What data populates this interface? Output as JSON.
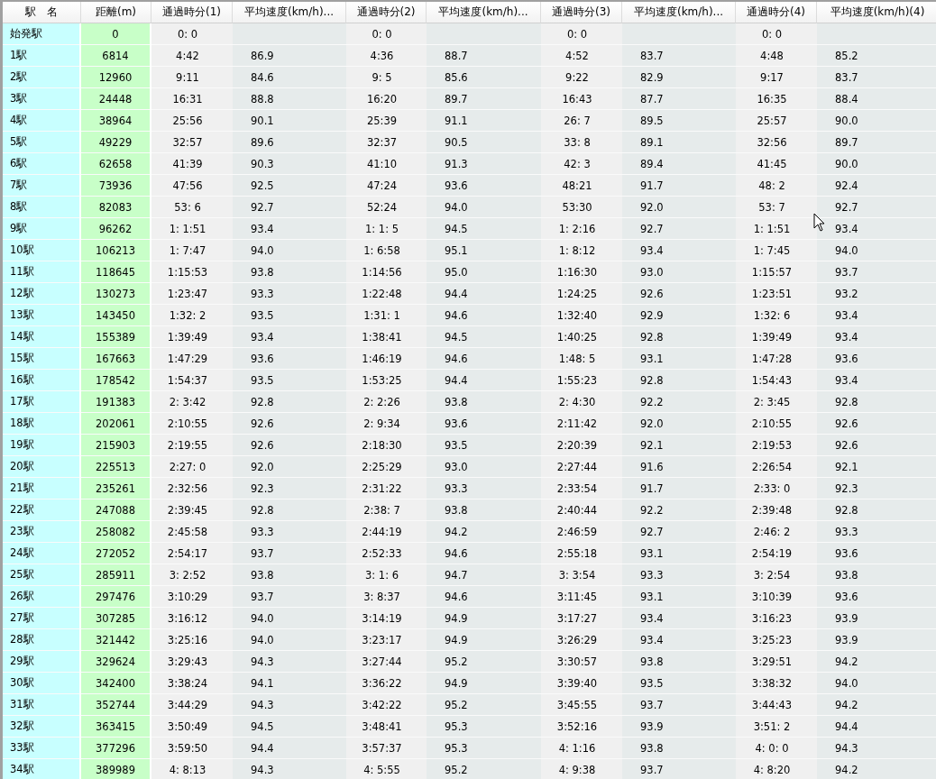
{
  "table": {
    "columns": [
      "駅　名",
      "距離(m)",
      "通過時分(1)",
      "平均速度(km/h)...",
      "通過時分(2)",
      "平均速度(km/h)...",
      "通過時分(3)",
      "平均速度(km/h)...",
      "通過時分(4)",
      "平均速度(km/h)(4)"
    ],
    "rows": [
      {
        "station": "始発駅",
        "distance": "0",
        "times": [
          "0: 0",
          "0: 0",
          "0: 0",
          "0: 0"
        ]
      },
      {
        "station": "1駅",
        "distance": "6814",
        "times": [
          "4:42",
          "4:36",
          "4:52",
          "4:48"
        ],
        "speeds": [
          "86.9",
          "88.7",
          "83.7",
          "85.2"
        ]
      },
      {
        "station": "2駅",
        "distance": "12960",
        "times": [
          "9:11",
          "9: 5",
          "9:22",
          "9:17"
        ],
        "speeds": [
          "84.6",
          "85.6",
          "82.9",
          "83.7"
        ]
      },
      {
        "station": "3駅",
        "distance": "24448",
        "times": [
          "16:31",
          "16:20",
          "16:43",
          "16:35"
        ],
        "speeds": [
          "88.8",
          "89.7",
          "87.7",
          "88.4"
        ]
      },
      {
        "station": "4駅",
        "distance": "38964",
        "times": [
          "25:56",
          "25:39",
          "26: 7",
          "25:57"
        ],
        "speeds": [
          "90.1",
          "91.1",
          "89.5",
          "90.0"
        ]
      },
      {
        "station": "5駅",
        "distance": "49229",
        "times": [
          "32:57",
          "32:37",
          "33: 8",
          "32:56"
        ],
        "speeds": [
          "89.6",
          "90.5",
          "89.1",
          "89.7"
        ]
      },
      {
        "station": "6駅",
        "distance": "62658",
        "times": [
          "41:39",
          "41:10",
          "42: 3",
          "41:45"
        ],
        "speeds": [
          "90.3",
          "91.3",
          "89.4",
          "90.0"
        ]
      },
      {
        "station": "7駅",
        "distance": "73936",
        "times": [
          "47:56",
          "47:24",
          "48:21",
          "48: 2"
        ],
        "speeds": [
          "92.5",
          "93.6",
          "91.7",
          "92.4"
        ]
      },
      {
        "station": "8駅",
        "distance": "82083",
        "times": [
          "53: 6",
          "52:24",
          "53:30",
          "53: 7"
        ],
        "speeds": [
          "92.7",
          "94.0",
          "92.0",
          "92.7"
        ]
      },
      {
        "station": "9駅",
        "distance": "96262",
        "times": [
          "1: 1:51",
          "1: 1: 5",
          "1: 2:16",
          "1: 1:51"
        ],
        "speeds": [
          "93.4",
          "94.5",
          "92.7",
          "93.4"
        ]
      },
      {
        "station": "10駅",
        "distance": "106213",
        "times": [
          "1: 7:47",
          "1: 6:58",
          "1: 8:12",
          "1: 7:45"
        ],
        "speeds": [
          "94.0",
          "95.1",
          "93.4",
          "94.0"
        ]
      },
      {
        "station": "11駅",
        "distance": "118645",
        "times": [
          "1:15:53",
          "1:14:56",
          "1:16:30",
          "1:15:57"
        ],
        "speeds": [
          "93.8",
          "95.0",
          "93.0",
          "93.7"
        ]
      },
      {
        "station": "12駅",
        "distance": "130273",
        "times": [
          "1:23:47",
          "1:22:48",
          "1:24:25",
          "1:23:51"
        ],
        "speeds": [
          "93.3",
          "94.4",
          "92.6",
          "93.2"
        ]
      },
      {
        "station": "13駅",
        "distance": "143450",
        "times": [
          "1:32: 2",
          "1:31: 1",
          "1:32:40",
          "1:32: 6"
        ],
        "speeds": [
          "93.5",
          "94.6",
          "92.9",
          "93.4"
        ]
      },
      {
        "station": "14駅",
        "distance": "155389",
        "times": [
          "1:39:49",
          "1:38:41",
          "1:40:25",
          "1:39:49"
        ],
        "speeds": [
          "93.4",
          "94.5",
          "92.8",
          "93.4"
        ]
      },
      {
        "station": "15駅",
        "distance": "167663",
        "times": [
          "1:47:29",
          "1:46:19",
          "1:48: 5",
          "1:47:28"
        ],
        "speeds": [
          "93.6",
          "94.6",
          "93.1",
          "93.6"
        ]
      },
      {
        "station": "16駅",
        "distance": "178542",
        "times": [
          "1:54:37",
          "1:53:25",
          "1:55:23",
          "1:54:43"
        ],
        "speeds": [
          "93.5",
          "94.4",
          "92.8",
          "93.4"
        ]
      },
      {
        "station": "17駅",
        "distance": "191383",
        "times": [
          "2: 3:42",
          "2: 2:26",
          "2: 4:30",
          "2: 3:45"
        ],
        "speeds": [
          "92.8",
          "93.8",
          "92.2",
          "92.8"
        ]
      },
      {
        "station": "18駅",
        "distance": "202061",
        "times": [
          "2:10:55",
          "2: 9:34",
          "2:11:42",
          "2:10:55"
        ],
        "speeds": [
          "92.6",
          "93.6",
          "92.0",
          "92.6"
        ]
      },
      {
        "station": "19駅",
        "distance": "215903",
        "times": [
          "2:19:55",
          "2:18:30",
          "2:20:39",
          "2:19:53"
        ],
        "speeds": [
          "92.6",
          "93.5",
          "92.1",
          "92.6"
        ]
      },
      {
        "station": "20駅",
        "distance": "225513",
        "times": [
          "2:27: 0",
          "2:25:29",
          "2:27:44",
          "2:26:54"
        ],
        "speeds": [
          "92.0",
          "93.0",
          "91.6",
          "92.1"
        ]
      },
      {
        "station": "21駅",
        "distance": "235261",
        "times": [
          "2:32:56",
          "2:31:22",
          "2:33:54",
          "2:33: 0"
        ],
        "speeds": [
          "92.3",
          "93.3",
          "91.7",
          "92.3"
        ]
      },
      {
        "station": "22駅",
        "distance": "247088",
        "times": [
          "2:39:45",
          "2:38: 7",
          "2:40:44",
          "2:39:48"
        ],
        "speeds": [
          "92.8",
          "93.8",
          "92.2",
          "92.8"
        ]
      },
      {
        "station": "23駅",
        "distance": "258082",
        "times": [
          "2:45:58",
          "2:44:19",
          "2:46:59",
          "2:46: 2"
        ],
        "speeds": [
          "93.3",
          "94.2",
          "92.7",
          "93.3"
        ]
      },
      {
        "station": "24駅",
        "distance": "272052",
        "times": [
          "2:54:17",
          "2:52:33",
          "2:55:18",
          "2:54:19"
        ],
        "speeds": [
          "93.7",
          "94.6",
          "93.1",
          "93.6"
        ]
      },
      {
        "station": "25駅",
        "distance": "285911",
        "times": [
          "3: 2:52",
          "3: 1: 6",
          "3: 3:54",
          "3: 2:54"
        ],
        "speeds": [
          "93.8",
          "94.7",
          "93.3",
          "93.8"
        ]
      },
      {
        "station": "26駅",
        "distance": "297476",
        "times": [
          "3:10:29",
          "3: 8:37",
          "3:11:45",
          "3:10:39"
        ],
        "speeds": [
          "93.7",
          "94.6",
          "93.1",
          "93.6"
        ]
      },
      {
        "station": "27駅",
        "distance": "307285",
        "times": [
          "3:16:12",
          "3:14:19",
          "3:17:27",
          "3:16:23"
        ],
        "speeds": [
          "94.0",
          "94.9",
          "93.4",
          "93.9"
        ]
      },
      {
        "station": "28駅",
        "distance": "321442",
        "times": [
          "3:25:16",
          "3:23:17",
          "3:26:29",
          "3:25:23"
        ],
        "speeds": [
          "94.0",
          "94.9",
          "93.4",
          "93.9"
        ]
      },
      {
        "station": "29駅",
        "distance": "329624",
        "times": [
          "3:29:43",
          "3:27:44",
          "3:30:57",
          "3:29:51"
        ],
        "speeds": [
          "94.3",
          "95.2",
          "93.8",
          "94.2"
        ]
      },
      {
        "station": "30駅",
        "distance": "342400",
        "times": [
          "3:38:24",
          "3:36:22",
          "3:39:40",
          "3:38:32"
        ],
        "speeds": [
          "94.1",
          "94.9",
          "93.5",
          "94.0"
        ]
      },
      {
        "station": "31駅",
        "distance": "352744",
        "times": [
          "3:44:29",
          "3:42:22",
          "3:45:55",
          "3:44:43"
        ],
        "speeds": [
          "94.3",
          "95.2",
          "93.7",
          "94.2"
        ]
      },
      {
        "station": "32駅",
        "distance": "363415",
        "times": [
          "3:50:49",
          "3:48:41",
          "3:52:16",
          "3:51: 2"
        ],
        "speeds": [
          "94.5",
          "95.3",
          "93.9",
          "94.4"
        ]
      },
      {
        "station": "33駅",
        "distance": "377296",
        "times": [
          "3:59:50",
          "3:57:37",
          "4: 1:16",
          "4: 0: 0"
        ],
        "speeds": [
          "94.4",
          "95.3",
          "93.8",
          "94.3"
        ]
      },
      {
        "station": "34駅",
        "distance": "389989",
        "times": [
          "4: 8:13",
          "4: 5:55",
          "4: 9:38",
          "4: 8:20"
        ],
        "speeds": [
          "94.3",
          "95.2",
          "93.7",
          "94.2"
        ]
      }
    ]
  }
}
